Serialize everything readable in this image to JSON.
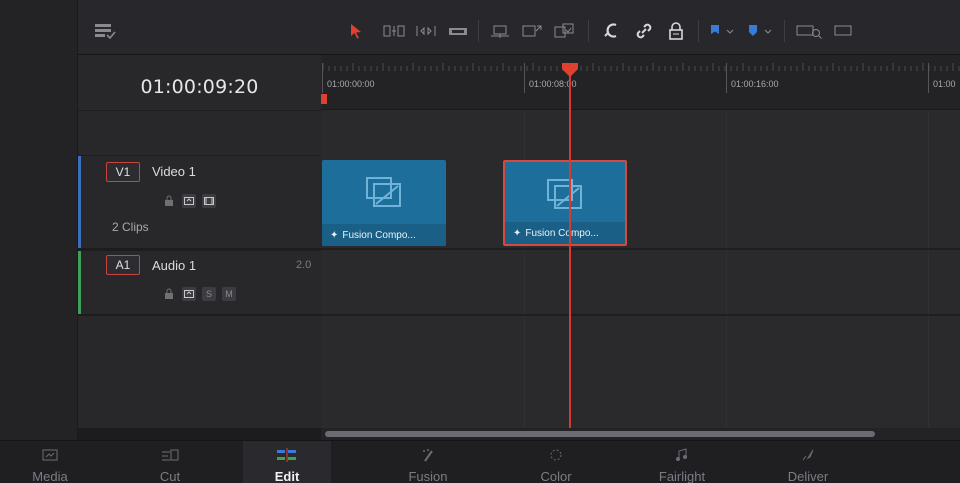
{
  "toolbar": {
    "colors": {
      "pointer": "#e0402f",
      "flag": "#3b7bd8",
      "marker": "#3b7bd8"
    }
  },
  "timecode": "01:00:09:20",
  "ruler": {
    "labels": [
      "01:00:00:00",
      "01:00:08:00",
      "01:00:16:00",
      "01:00"
    ]
  },
  "tracks": {
    "video": {
      "id": "V1",
      "name": "Video 1",
      "clips_count": "2 Clips",
      "color": "#3b6fbf"
    },
    "audio": {
      "id": "A1",
      "name": "Audio 1",
      "channel": "2.0",
      "solo": "S",
      "mute": "M",
      "color": "#3fa05a"
    }
  },
  "clips": [
    {
      "label": "Fusion Compo...",
      "selected": false
    },
    {
      "label": "Fusion Compo...",
      "selected": true
    }
  ],
  "pages": [
    {
      "label": "Media",
      "icon": "media-icon",
      "active": false
    },
    {
      "label": "Cut",
      "icon": "cut-icon",
      "active": false
    },
    {
      "label": "Edit",
      "icon": "edit-icon",
      "active": true
    },
    {
      "label": "Fusion",
      "icon": "fusion-icon",
      "active": false
    },
    {
      "label": "Color",
      "icon": "color-icon",
      "active": false
    },
    {
      "label": "Fairlight",
      "icon": "fairlight-icon",
      "active": false
    },
    {
      "label": "Deliver",
      "icon": "deliver-icon",
      "active": false
    }
  ]
}
